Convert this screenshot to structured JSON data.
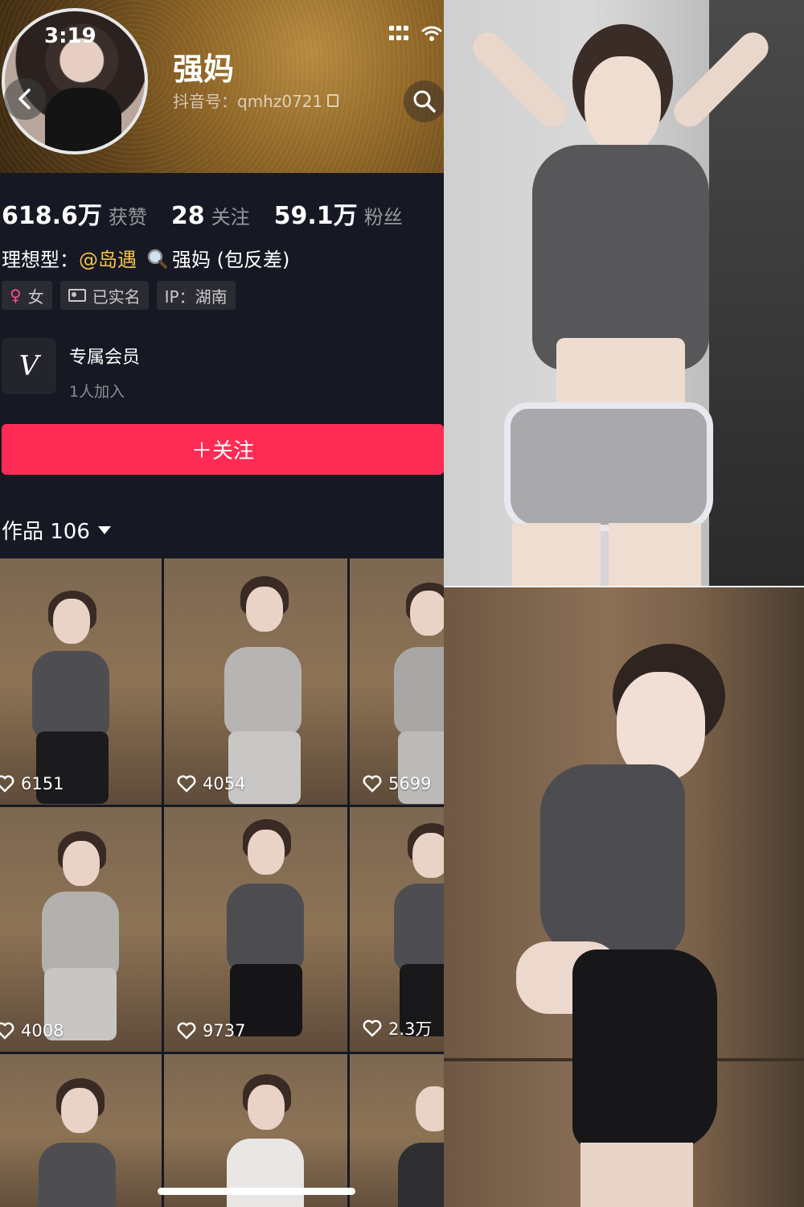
{
  "status_bar": {
    "time": "3:19"
  },
  "profile": {
    "name": "强妈",
    "douyin_id": "抖音号：qmhz0721",
    "stats": [
      {
        "value": "618.6万",
        "label": "获赞"
      },
      {
        "value": "28",
        "label": "关注"
      },
      {
        "value": "59.1万",
        "label": "粉丝"
      }
    ],
    "bio": {
      "prefix": "理想型：",
      "mention": "@岛遇",
      "suffix": "强妈 (包反差)"
    },
    "tags": [
      {
        "icon": "female-icon",
        "label": "女"
      },
      {
        "icon": "id-card-icon",
        "label": "已实名"
      },
      {
        "icon": "",
        "label": "IP：湖南"
      }
    ]
  },
  "membership": {
    "logo": "V",
    "title": "专属会员",
    "subtitle": "1人加入"
  },
  "follow_button": {
    "label": "＋关注"
  },
  "works": {
    "header": "作品 106"
  },
  "thumbnails": [
    {
      "likes": "6151"
    },
    {
      "likes": "4054"
    },
    {
      "likes": "5699"
    },
    {
      "likes": "4008"
    },
    {
      "likes": "9737"
    },
    {
      "likes": "2.3万"
    }
  ],
  "colors": {
    "accent": "#fe2c55",
    "mention": "#f5c24b",
    "background": "#161823"
  }
}
